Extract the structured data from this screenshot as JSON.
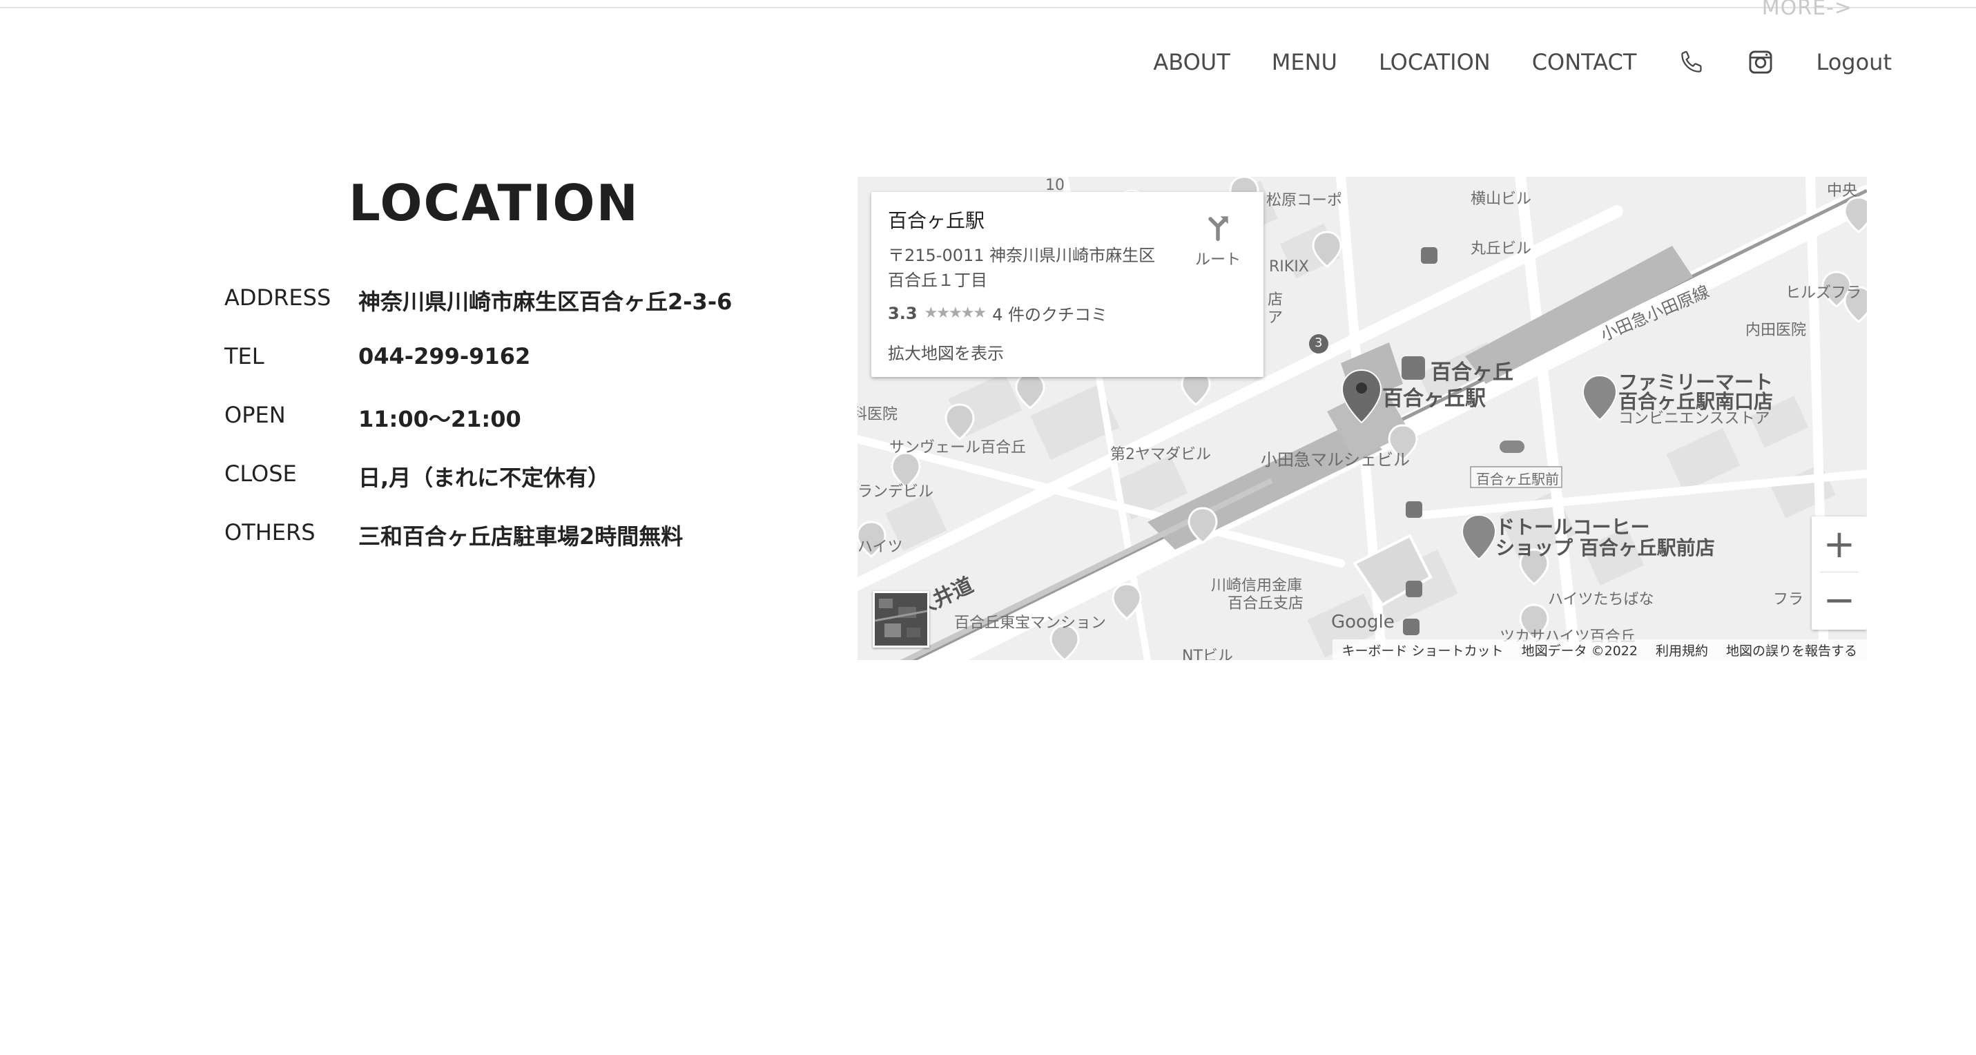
{
  "header": {
    "more_link": "MORE->",
    "nav": {
      "about": "ABOUT",
      "menu": "MENU",
      "location": "LOCATION",
      "contact": "CONTACT",
      "logout": "Logout"
    },
    "icons": [
      "phone-icon",
      "instagram-icon"
    ]
  },
  "location": {
    "title": "LOCATION",
    "rows": [
      {
        "label": "ADDRESS",
        "value": "神奈川県川崎市麻生区百合ヶ丘2-3-6"
      },
      {
        "label": "TEL",
        "value": "044-299-9162"
      },
      {
        "label": "OPEN",
        "value": "11:00〜21:00"
      },
      {
        "label": "CLOSE",
        "value": "日,月（まれに不定休有）"
      },
      {
        "label": "OTHERS",
        "value": "三和百合ヶ丘店駐車場2時間無料"
      }
    ]
  },
  "map": {
    "card": {
      "title": "百合ヶ丘駅",
      "address": "〒215-0011 神奈川県川崎市麻生区百合丘１丁目",
      "rating": "3.3",
      "stars": "★★★★★",
      "reviews": "4 件のクチコミ",
      "expand_link": "拡大地図を表示",
      "route_label": "ルート"
    },
    "labels": {
      "yurigaoka_station": "百合ヶ丘駅",
      "yurigaoka": "百合ヶ丘",
      "odakyu_line": "小田急小田原線",
      "famima": "ファミリーマート",
      "famima2": "百合ヶ丘駅南口店",
      "famima3": "コンビニエンスストア",
      "doutor": "ドトールコーヒー",
      "doutor2": "ショップ 百合ヶ丘駅前店",
      "marushe": "小田急マルシェビル",
      "ekimae": "百合ヶ丘駅前",
      "shinkin": "川崎信用金庫",
      "shinkin2": "百合丘支店",
      "higashiho": "百合丘東宝マンション",
      "heights": "ハイツたちばな",
      "tsukasa": "ツカサハイツ百合丘",
      "sunvale": "サンヴェール百合丘",
      "yamada": "第2ヤマダビル",
      "rikix": "RIKIX",
      "marugaoka": "丸丘ビル",
      "matsubara": "松原コーポ",
      "yokoyama": "横山ビル",
      "hills": "ヒルズフラ",
      "uchida": "内田医院",
      "dental": "歯科医院",
      "landebil": "ランデビル",
      "heitsu": "ハイツ",
      "ntbil": "NTビル",
      "tsuido": "津久井道",
      "ten": "10",
      "num3": "3",
      "chuo": "中央",
      "shop": "店",
      "a": "ア",
      "fura": "フラ"
    },
    "google": "Google",
    "attribution": [
      "キーボード ショートカット",
      "地図データ ©2022",
      "利用規約",
      "地図の誤りを報告する"
    ],
    "zoom_in": "+",
    "zoom_out": "−"
  }
}
